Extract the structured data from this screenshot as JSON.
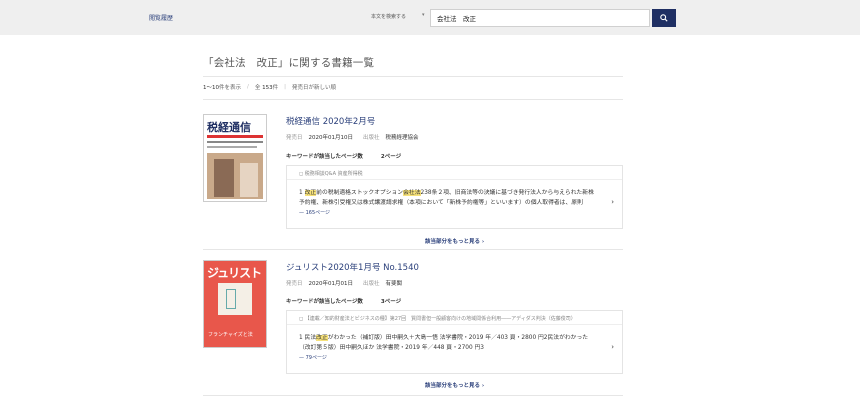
{
  "header": {
    "history_label": "閲覧履歴",
    "search_scope": "本文を検索する",
    "search_value": "会社法　改正"
  },
  "results": {
    "title": "「会社法　改正」に関する書籍一覧",
    "range": "1〜10",
    "range_suffix": "件を表示",
    "total_prefix": "全",
    "total": "153",
    "total_suffix": "件",
    "sort": "発売日が新しい順"
  },
  "books": [
    {
      "title": "税経通信 2020年2月号",
      "date_label": "発売日",
      "date": "2020年01月10日",
      "publisher_label": "出版社",
      "publisher": "税務経理協会",
      "kw_label": "キーワードが該当したページ数",
      "kw_count": "2ページ",
      "section": "税務相談Q&A 資産所得税",
      "snippet_pre": "1 ",
      "snippet_hl1": "改正",
      "snippet_mid": "前の税制適格ストックオプション",
      "snippet_hl2": "会社法",
      "snippet_post": "238条２項、旧商法等の決議に基づき発行法人から与えられた新株予約権、新株引受権又は株式譲渡請求権（本項において「新株予約権等」といいます）の個人取得者は、原則",
      "page": "165ページ",
      "more": "該当部分をもっと見る",
      "cover_title": "税経通信"
    },
    {
      "title": "ジュリスト2020年1月号 No.1540",
      "date_label": "発売日",
      "date": "2020年01月01日",
      "publisher_label": "出版社",
      "publisher": "有斐閣",
      "kw_label": "キーワードが該当したページ数",
      "kw_count": "3ページ",
      "section": "【連載／知的財産法とビジネスの種】第27回　質問書但一般顧客向けの地域間係合利用――アディダス判決（佐藤俊司）",
      "snippet_pre": "1 民法",
      "snippet_hl1": "改正",
      "snippet_mid": "がわかった（補訂版）田中嗣久＋大島一悟 法学書院・2019 年／403 頁・2800 円2民法がわかった（改訂第５版）田中嗣久ほか 法学書院・2019 年／448 頁・2700 円3",
      "snippet_hl2": "",
      "snippet_post": "",
      "page": "79ページ",
      "more": "該当部分をもっと見る",
      "cover_title": "ジュリスト",
      "cover_caption": "フランチャイズと法"
    }
  ],
  "colors": {
    "navy": "#1f2f63",
    "link": "#2a3f7a",
    "highlight": "#f7e27a",
    "jurist_red": "#e8574b"
  }
}
